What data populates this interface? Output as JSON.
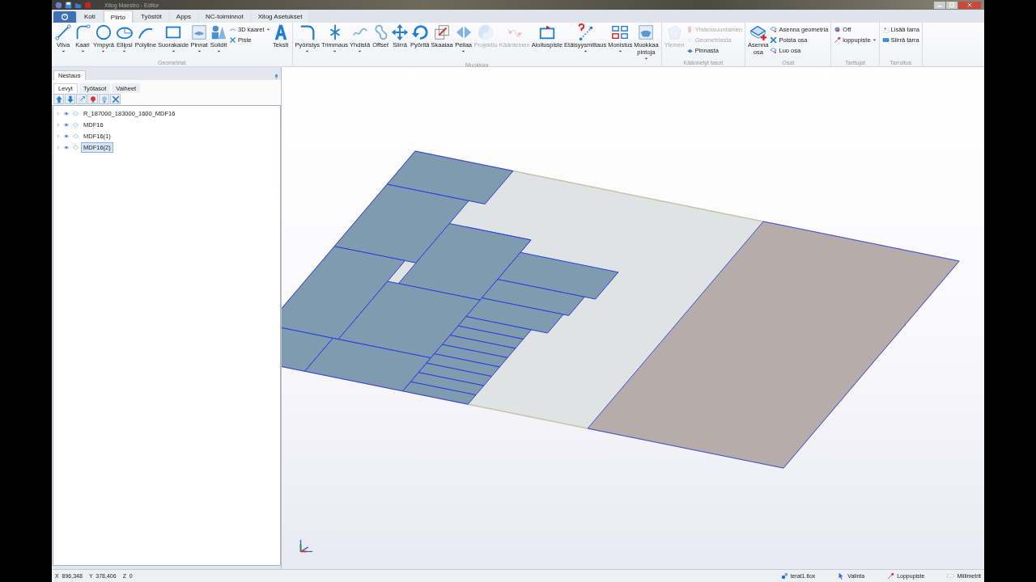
{
  "window": {
    "title": "Xilog Maestro - Editor"
  },
  "ribbon": {
    "tabs": [
      {
        "label": "Koti",
        "selected": false
      },
      {
        "label": "Piirto",
        "selected": true
      },
      {
        "label": "Työstöt",
        "selected": false
      },
      {
        "label": "Apps",
        "selected": false
      },
      {
        "label": "NC-toiminnot",
        "selected": false
      },
      {
        "label": "Xilog Asetukset",
        "selected": false
      }
    ],
    "groups": [
      {
        "label": "Geometriat",
        "items": [
          {
            "kind": "large",
            "label": "Viiva",
            "dropdown": true,
            "disabled": false
          },
          {
            "kind": "large",
            "label": "Kaari",
            "dropdown": true,
            "disabled": false
          },
          {
            "kind": "large",
            "label": "Ympyrä",
            "dropdown": true,
            "disabled": false
          },
          {
            "kind": "large",
            "label": "Ellipsi",
            "dropdown": true,
            "disabled": false
          },
          {
            "kind": "large",
            "label": "Polyline",
            "dropdown": false,
            "disabled": false
          },
          {
            "kind": "large",
            "label": "Suorakaide",
            "dropdown": true,
            "disabled": false
          },
          {
            "kind": "large",
            "label": "Pinnat",
            "dropdown": true,
            "disabled": false
          },
          {
            "kind": "large",
            "label": "Solidit",
            "dropdown": true,
            "disabled": false
          },
          {
            "kind": "stack",
            "items": [
              {
                "label": "3D kaaret",
                "dropdown": true,
                "disabled": false
              },
              {
                "label": "Piste",
                "dropdown": false,
                "disabled": false
              }
            ]
          },
          {
            "kind": "large",
            "label": "Teksti",
            "dropdown": false,
            "disabled": false
          }
        ]
      },
      {
        "label": "Muokkaa",
        "items": [
          {
            "kind": "large",
            "label": "Pyöristys",
            "dropdown": true,
            "disabled": false
          },
          {
            "kind": "large",
            "label": "Trimmaus",
            "dropdown": true,
            "disabled": false
          },
          {
            "kind": "large",
            "label": "Yhdistä",
            "dropdown": true,
            "disabled": false
          },
          {
            "kind": "large",
            "label": "Offset",
            "dropdown": false,
            "disabled": false
          },
          {
            "kind": "large",
            "label": "Siirrä",
            "dropdown": false,
            "disabled": false
          },
          {
            "kind": "large",
            "label": "Pyöritä",
            "dropdown": false,
            "disabled": false
          },
          {
            "kind": "large",
            "label": "Skaalaa",
            "dropdown": false,
            "disabled": false
          },
          {
            "kind": "large",
            "label": "Peilaa",
            "dropdown": true,
            "disabled": false
          },
          {
            "kind": "large",
            "label": "Projektio",
            "dropdown": false,
            "disabled": true
          },
          {
            "kind": "large",
            "label": "Käänteinen",
            "dropdown": false,
            "disabled": true
          },
          {
            "kind": "large",
            "label": "Aloituspiste",
            "dropdown": false,
            "disabled": false
          },
          {
            "kind": "large",
            "label": "Etäisyysmittaus",
            "dropdown": true,
            "disabled": false
          },
          {
            "kind": "large",
            "label": "Monistus",
            "dropdown": true,
            "disabled": false
          },
          {
            "kind": "large",
            "label": "Muokkaa pintoja",
            "dropdown": true,
            "disabled": false
          }
        ]
      },
      {
        "label": "Käännetyt tasot",
        "items": [
          {
            "kind": "large",
            "label": "Yleinen",
            "dropdown": false,
            "disabled": true
          },
          {
            "kind": "stack",
            "items": [
              {
                "label": "Yhdensuuntainen",
                "dropdown": false,
                "disabled": true
              },
              {
                "label": "Geometriasta",
                "dropdown": false,
                "disabled": true
              },
              {
                "label": "Pinnasta",
                "dropdown": false,
                "disabled": false
              }
            ]
          }
        ]
      },
      {
        "label": "Osat",
        "items": [
          {
            "kind": "large",
            "label": "Asenna osa",
            "dropdown": false,
            "disabled": false
          },
          {
            "kind": "stack",
            "items": [
              {
                "label": "Asenna geometria",
                "dropdown": false,
                "disabled": false
              },
              {
                "label": "Poista osa",
                "dropdown": false,
                "disabled": false
              },
              {
                "label": "Luo osa",
                "dropdown": false,
                "disabled": false
              }
            ]
          }
        ]
      },
      {
        "label": "Tarttujat",
        "items": [
          {
            "kind": "stack",
            "items": [
              {
                "label": "Off",
                "dropdown": false,
                "disabled": false
              },
              {
                "label": "loppupiste",
                "dropdown": true,
                "disabled": false
              }
            ]
          }
        ]
      },
      {
        "label": "Tarroitus",
        "items": [
          {
            "kind": "stack",
            "items": [
              {
                "label": "Lisää tarra",
                "dropdown": false,
                "disabled": false
              },
              {
                "label": "Siirrä tarra",
                "dropdown": false,
                "disabled": false
              }
            ]
          }
        ]
      }
    ]
  },
  "panel": {
    "title": "Nestaus",
    "tabs": [
      {
        "label": "Levyt",
        "selected": true
      },
      {
        "label": "Työtasot",
        "selected": false
      },
      {
        "label": "Vaiheet",
        "selected": false
      }
    ],
    "tree": [
      {
        "label": "R_187000_183000_1600_MDF16",
        "selected": false
      },
      {
        "label": "MDF16",
        "selected": false
      },
      {
        "label": "MDF16(1)",
        "selected": false
      },
      {
        "label": "MDF16(2)",
        "selected": true
      }
    ]
  },
  "status_bar": {
    "coords": [
      "X  896,348",
      "Y  378,406",
      "Z  0"
    ],
    "items": [
      "terat1.tlox",
      "Valinta",
      "Loppupiste",
      "Millimetrit"
    ]
  }
}
